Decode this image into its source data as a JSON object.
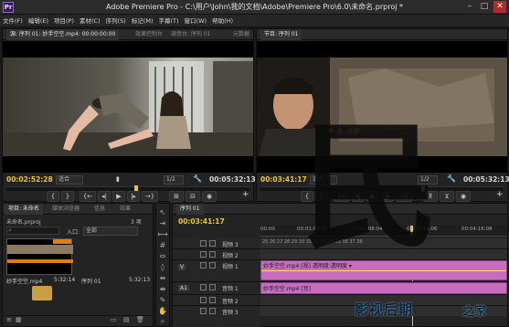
{
  "app": {
    "title": "Adobe Premiere Pro - C:\\用户\\John\\我的文档\\Adobe\\Premiere Pro\\6.0\\未命名.prproj *",
    "icon_text": "Pr"
  },
  "window_controls": {
    "minimize": "–",
    "maximize": "□",
    "close": "✕"
  },
  "menu": [
    "文件(F)",
    "编辑(E)",
    "项目(P)",
    "素材(C)",
    "序列(S)",
    "标记(M)",
    "字幕(T)",
    "窗口(W)",
    "帮助(H)"
  ],
  "source_monitor": {
    "tabs": [
      "源: 序列 01: 妙手空空.mp4: 00:00:00:00",
      "效果控制台",
      "调音台: 序列 01",
      "元数据"
    ],
    "tc_current": "00:02:52:28",
    "fit": "适合",
    "ratio": "1/2",
    "tc_duration": "00:05:32:13"
  },
  "program_monitor": {
    "tabs": [
      "节目: 序列 01"
    ],
    "tc_current": "00:03:41:17",
    "fit": "适合",
    "ratio": "1/2",
    "tc_duration": "00:05:32:13",
    "subtitle": "年·多 ·场梦"
  },
  "project_panel": {
    "tabs": [
      "项目: 未命名",
      "媒体浏览器",
      "信息",
      "效果"
    ],
    "project_file": "未命名.prproj",
    "item_count": "3 项",
    "in_label": "入口:",
    "in_value": "全部",
    "items": [
      {
        "name": "妙手空空.mp4",
        "duration": "5:32:14"
      },
      {
        "name": "序列 01",
        "duration": "5:32:13"
      }
    ]
  },
  "tools_panel": {
    "icons": [
      "selection-tool-icon",
      "track-select-icon",
      "ripple-edit-icon",
      "rolling-edit-icon",
      "rate-stretch-icon",
      "razor-icon",
      "slip-icon",
      "slide-icon",
      "pen-icon",
      "hand-icon",
      "zoom-icon"
    ]
  },
  "timeline": {
    "tabs": [
      "序列 01"
    ],
    "tc_current": "00:03:41:17",
    "ruler": [
      "00:00",
      "00:01:04:02",
      "00:02:08:04",
      "00:03:12:06",
      "00:04:16:08"
    ],
    "tracks": [
      {
        "label": "视频 3"
      },
      {
        "label": "视频 2"
      },
      {
        "label": "视频 1",
        "clip": "妙手空空.mp4 [视] 透明度:透明度 ▾"
      },
      {
        "label": "音频 1",
        "clip": "妙手空空.mp4 [音]"
      },
      {
        "label": "音频 2"
      },
      {
        "label": "音频 3"
      }
    ],
    "source_patch_v": "V",
    "source_patch_a": "A1",
    "frame_numbers": "25 26 27 28 29 30 31 32 33 34 35 36 37 38"
  },
  "watermark": {
    "big_glyph": "民",
    "brand": "影视后期",
    "brand_suffix": "之家"
  },
  "colors": {
    "accent_timecode": "#e8c436",
    "video_clip": "#c76cbf",
    "audio_clip": "#c76cbf",
    "playhead": "#e8c436"
  }
}
